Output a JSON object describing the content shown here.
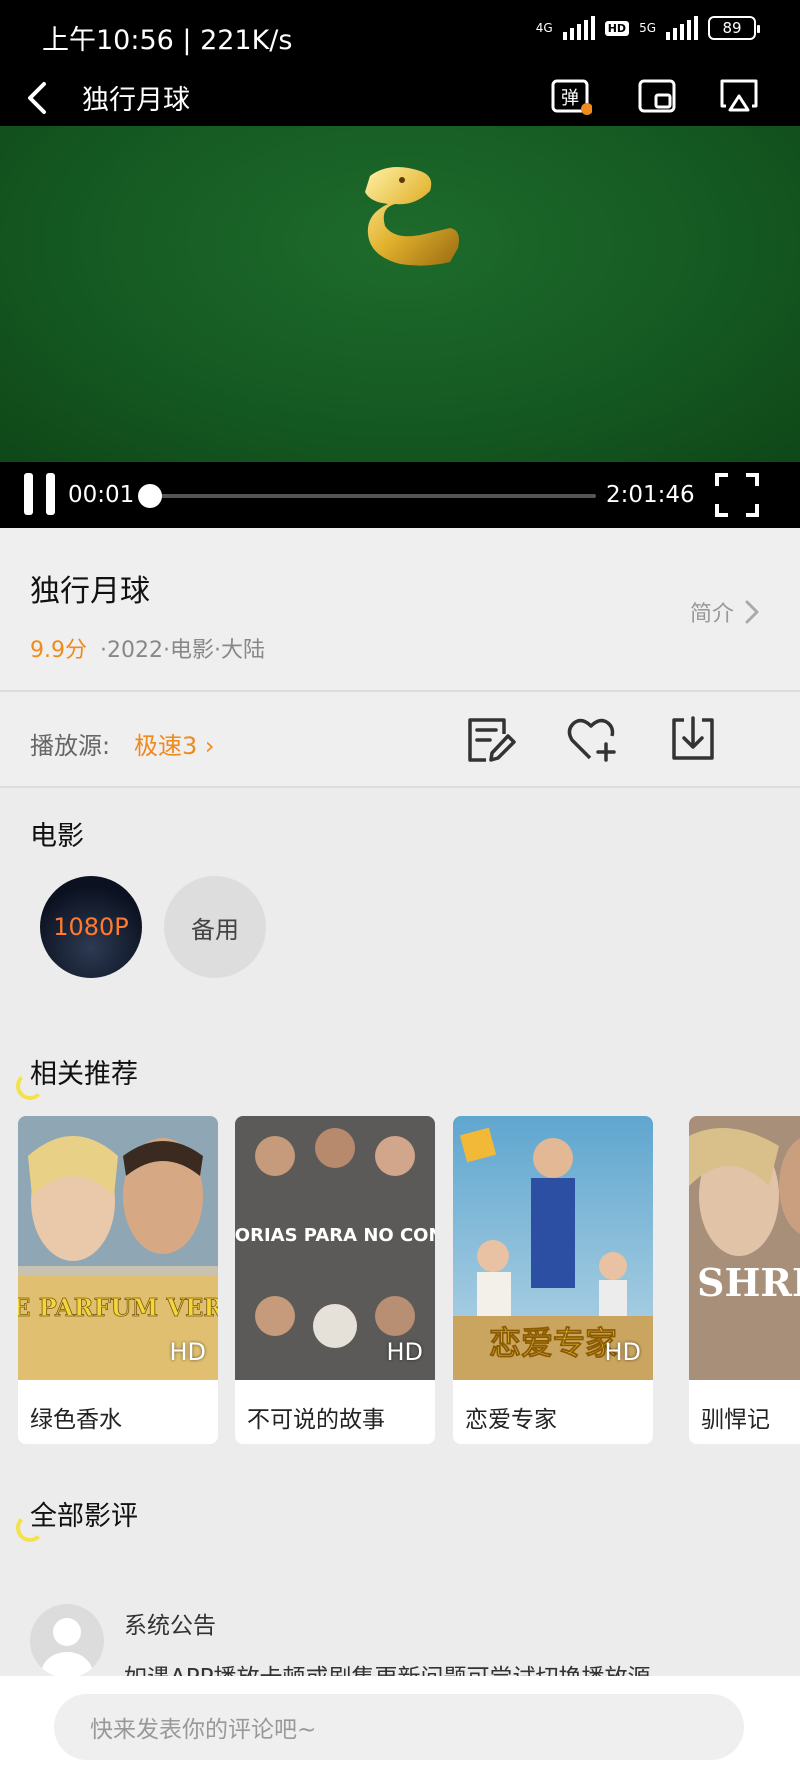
{
  "status_bar": {
    "time": "上午10:56 | 221K/s",
    "network_1": "4G",
    "hd_badge": "HD",
    "network_2": "5G",
    "battery": "89"
  },
  "nav": {
    "title": "独行月球",
    "danmaku_label": "弹"
  },
  "player": {
    "current_time": "00:01",
    "total_time": "2:01:46",
    "progress": 0.0001
  },
  "movie": {
    "title": "独行月球",
    "score": "9.9分",
    "meta": "·2022·电影·大陆",
    "intro_label": "简介"
  },
  "source": {
    "label": "播放源:",
    "value": "极速3 ›"
  },
  "episodes": {
    "title": "电影",
    "items": [
      "1080P",
      "备用"
    ]
  },
  "recommend": {
    "title": "相关推荐",
    "items": [
      {
        "name": "绿色香水",
        "badge": "HD",
        "poster_title": "LE PARFUM VERT"
      },
      {
        "name": "不可说的故事",
        "badge": "HD",
        "poster_title": "HISTORIAS PARA NO CONTAR"
      },
      {
        "name": "恋爱专家",
        "badge": "HD",
        "poster_title": "恋爱专家"
      },
      {
        "name": "驯悍记",
        "badge": "",
        "poster_title": "SHRE"
      }
    ]
  },
  "reviews": {
    "title": "全部影评",
    "items": [
      {
        "user": "系统公告",
        "text": "如遇APP播放卡顿或剧集更新问题可尝试切换播放源"
      }
    ]
  },
  "comment_input": {
    "placeholder": "快来发表你的评论吧~"
  },
  "colors": {
    "accent": "#f08a1c",
    "video_bg": "#155a22"
  }
}
